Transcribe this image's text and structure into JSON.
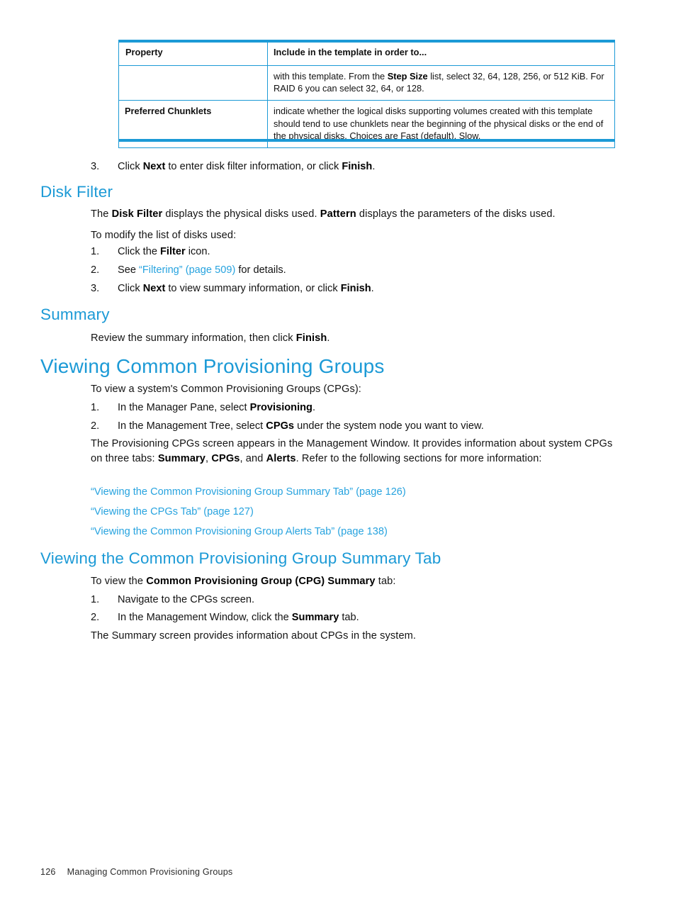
{
  "table": {
    "columns": [
      "Property",
      "Include in the template in order to..."
    ],
    "rows": [
      {
        "property": "",
        "desc_pre": "with this template. From the ",
        "desc_bold": "Step Size",
        "desc_post": " list, select 32, 64, 128, 256, or 512 KiB. For RAID 6 you can select 32, 64, or 128."
      },
      {
        "property": "Preferred Chunklets",
        "desc_pre": "indicate whether the logical disks supporting volumes created with this template should tend to use chunklets near the beginning of the physical disks or the end of the physical disks. Choices are Fast (default), Slow.",
        "desc_bold": "",
        "desc_post": ""
      }
    ]
  },
  "step3_top": {
    "num": "3.",
    "pre": "Click ",
    "b1": "Next",
    "mid": " to enter disk filter information, or click ",
    "b2": "Finish",
    "post": "."
  },
  "disk_filter": {
    "heading": "Disk Filter",
    "intro_pre": "The ",
    "intro_b1": "Disk Filter",
    "intro_mid": " displays the physical disks used. ",
    "intro_b2": "Pattern",
    "intro_post": " displays the parameters of the disks used.",
    "lead": "To modify the list of disks used:",
    "steps": [
      {
        "num": "1.",
        "pre": "Click the ",
        "b1": "Filter",
        "post": " icon."
      },
      {
        "num": "2.",
        "pre": "See ",
        "link": "“Filtering” (page 509)",
        "post": " for details."
      },
      {
        "num": "3.",
        "pre": "Click ",
        "b1": "Next",
        "mid": " to view summary information, or click ",
        "b2": "Finish",
        "post": "."
      }
    ]
  },
  "summary": {
    "heading": "Summary",
    "pre": "Review the summary information, then click ",
    "b1": "Finish",
    "post": "."
  },
  "viewing_cpgs": {
    "heading": "Viewing Common Provisioning Groups",
    "intro": "To view a system's Common Provisioning Groups (CPGs):",
    "steps": [
      {
        "num": "1.",
        "pre": "In the Manager Pane, select ",
        "b1": "Provisioning",
        "post": "."
      },
      {
        "num": "2.",
        "pre": "In the Management Tree, select ",
        "b1": "CPGs",
        "post": " under the system node you want to view."
      }
    ],
    "para_pre": "The Provisioning CPGs screen appears in the Management Window. It provides information about system CPGs on three tabs: ",
    "para_b1": "Summary",
    "para_sep1": ", ",
    "para_b2": "CPGs",
    "para_sep2": ", and ",
    "para_b3": "Alerts",
    "para_post": ". Refer to the following sections for more information:",
    "links": [
      "“Viewing the Common Provisioning Group Summary Tab” (page 126)",
      "“Viewing the CPGs Tab” (page 127)",
      "“Viewing the Common Provisioning Group Alerts Tab” (page 138)"
    ]
  },
  "viewing_summary_tab": {
    "heading": "Viewing the Common Provisioning Group Summary Tab",
    "intro_pre": "To view the ",
    "intro_b1": "Common Provisioning Group (CPG) Summary",
    "intro_post": " tab:",
    "steps": [
      {
        "num": "1.",
        "pre": "Navigate to the CPGs screen.",
        "b1": "",
        "post": ""
      },
      {
        "num": "2.",
        "pre": "In the Management Window, click the ",
        "b1": "Summary",
        "post": " tab."
      }
    ],
    "closing": "The Summary screen provides information about CPGs in the system."
  },
  "footer": {
    "page_number": "126",
    "chapter": "Managing Common Provisioning Groups"
  },
  "colors": {
    "accent": "#1c9ad6",
    "link": "#27a3df",
    "text": "#131313"
  }
}
